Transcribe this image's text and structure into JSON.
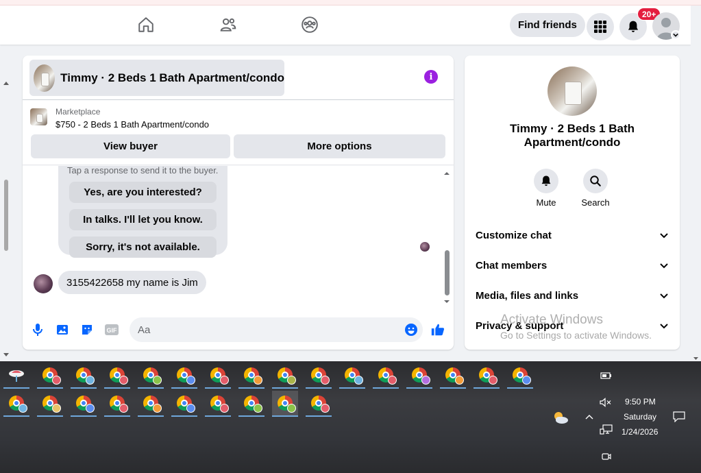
{
  "nav": {
    "find_friends_label": "Find friends",
    "notification_badge": "20+"
  },
  "chat": {
    "title": "Timmy · 2 Beds 1 Bath Apartment/condo",
    "listing": {
      "source": "Marketplace",
      "price_title": "$750 - 2 Beds 1 Bath Apartment/condo"
    },
    "view_buyer_label": "View buyer",
    "more_options_label": "More options",
    "quick_reply_hint": "Tap a response to send it to the buyer.",
    "quick_replies": [
      "Yes, are you interested?",
      "In talks. I'll let you know.",
      "Sorry, it's not available."
    ],
    "incoming_message": "3155422658 my name is Jim",
    "composer_placeholder": "Aa"
  },
  "info_panel": {
    "name": "Timmy · 2 Beds 1 Bath Apartment/condo",
    "mute_label": "Mute",
    "search_label": "Search",
    "sections": [
      "Customize chat",
      "Chat members",
      "Media, files and links",
      "Privacy & support"
    ]
  },
  "watermark": {
    "title": "Activate Windows",
    "subtitle": "Go to Settings to activate Windows."
  },
  "taskbar": {
    "time": "9:50 PM",
    "day": "Saturday",
    "date": "1/24/2026",
    "profile_colors": [
      "#e35d6a",
      "#6fb3e0",
      "#e35d6a",
      "#8bc34a",
      "#5b8def",
      "#e35d6a",
      "#f29b38",
      "#a9b44a",
      "#e35d6a",
      "#6fb3e0",
      "#e35d6a",
      "#b36fe0",
      "#f29b38",
      "#e35d6a",
      "#5b8def",
      "#6fb3e0",
      "#e9c46a",
      "#5b8def",
      "#e35d6a",
      "#f29b38",
      "#5b8def",
      "#e35d6a",
      "#8bc34a",
      "#8bc34a",
      "#e35d6a",
      "#8bc34a"
    ]
  },
  "colors": {
    "accent": "#0866ff",
    "info_purple": "#9b20e0",
    "badge_red": "#e41e3f"
  }
}
